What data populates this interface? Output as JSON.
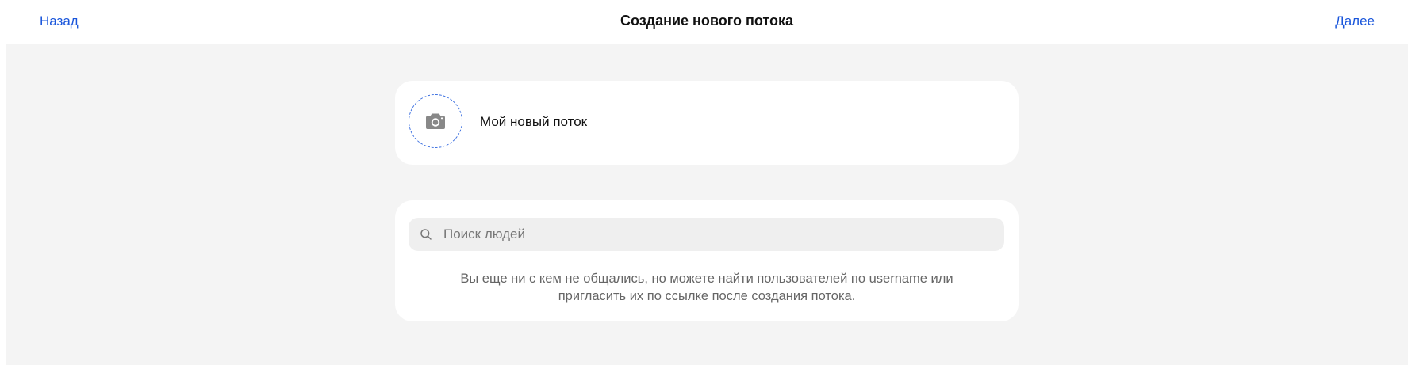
{
  "header": {
    "back_label": "Назад",
    "title": "Создание нового потока",
    "next_label": "Далее"
  },
  "stream": {
    "avatar_icon": "camera-icon",
    "name": "Мой новый поток"
  },
  "search": {
    "icon": "search-icon",
    "placeholder": "Поиск людей",
    "value": "",
    "hint_line1": "Вы еще ни с кем не общались, но можете найти пользователей по username или",
    "hint_line2": "пригласить их по ссылке после создания потока."
  },
  "colors": {
    "accent": "#1a56db",
    "background": "#f4f4f4",
    "card": "#ffffff",
    "search_bg": "#efefef",
    "avatar_border": "#3b6fe0"
  }
}
